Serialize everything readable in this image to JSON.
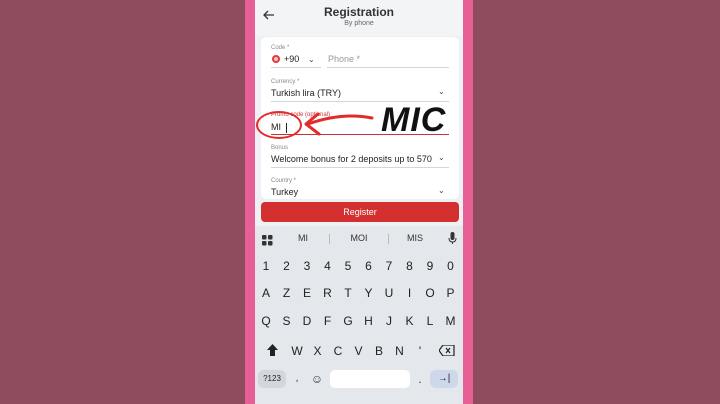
{
  "header": {
    "back_icon": "arrow-left-icon",
    "title": "Registration",
    "subtitle": "By phone"
  },
  "form": {
    "code_label": "Code *",
    "code_value": "+90",
    "phone_placeholder": "Phone *",
    "currency_label": "Currency *",
    "currency_value": "Turkish lira (TRY)",
    "promo_label": "Promo code (optional)",
    "promo_value": "MI",
    "bonus_label": "Bonus",
    "bonus_value": "Welcome bonus for 2 deposits up to 570",
    "country_label": "Country *",
    "country_value": "Turkey"
  },
  "overlay": {
    "annotation_text": "MIC"
  },
  "register_label": "Register",
  "keyboard": {
    "suggestions": [
      "MI",
      "MOI",
      "MIS"
    ],
    "row1": [
      "1",
      "2",
      "3",
      "4",
      "5",
      "6",
      "7",
      "8",
      "9",
      "0"
    ],
    "row2": [
      "A",
      "Z",
      "E",
      "R",
      "T",
      "Y",
      "U",
      "I",
      "O",
      "P"
    ],
    "row3": [
      "Q",
      "S",
      "D",
      "F",
      "G",
      "H",
      "J",
      "K",
      "L",
      "M"
    ],
    "row4": [
      "W",
      "X",
      "C",
      "V",
      "B",
      "N",
      "'"
    ],
    "num_label": "?123",
    "comma": ",",
    "period": "."
  },
  "colors": {
    "accent": "#d32f2f",
    "side_bar": "#e85f96",
    "background": "#8e4c5e"
  }
}
